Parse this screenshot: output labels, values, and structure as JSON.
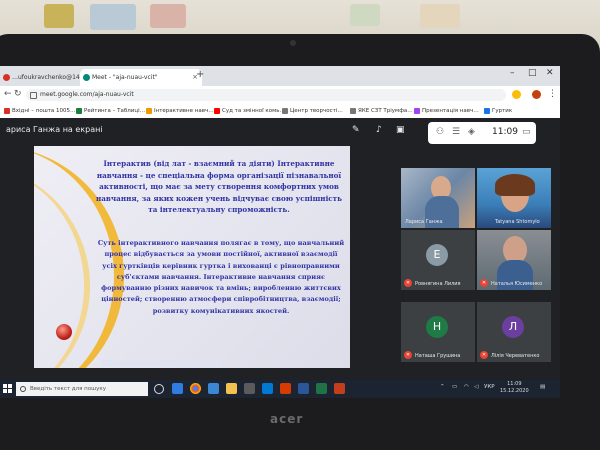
{
  "browser": {
    "tabs": [
      {
        "label": "…ufoukravchenko@14 ✉",
        "active": false
      },
      {
        "label": "Meet - \"aja-nuau-vcit\"",
        "active": true
      }
    ],
    "url": "meet.google.com/aja-nuau-vcit",
    "bookmarks": [
      "Вхідні – пошта 1005…",
      "Рейтинга – Таблиці…",
      "Інтерактивне навч…",
      "Суд та змінної комь…",
      "Центр творчості…",
      "ЯКЕ СЗТ Тріумфа…",
      "Презентація навч…",
      "Гуртик"
    ]
  },
  "meet": {
    "presenter_label": "ариса Ганжа на екрані",
    "time": "11:09",
    "slide": {
      "heading": "Інтерактив (від лат - взаємний та діяти) Інтерактивне навчання - це спеціальна форма організації пізнавальної активності, що має за мету створення комфортних умов навчання, за яких кожен учень відчуває свою успішність та інтелектуальну спроможність.",
      "body": "Суть інтерактивного навчання полягає в тому, що навчальний процес відбувається за умови постійної, активної взаємодії усіх гуртківців керівник гуртка і вихованці є рівноправними суб'єктами навчання. Інтерактивне навчання сприяє формуванню різних навичок та вмінь; виробленню життєвих цінностей; створенню атмосфери співробітництва, взаємодії; розвитку комунікативних якостей."
    },
    "participants": [
      {
        "name": "Лариса Ганжа",
        "initial": "",
        "color": "#5f6368"
      },
      {
        "name": "Tatyana Shtomylo",
        "initial": "",
        "color": "#5f6368"
      },
      {
        "name": "Ровнягина Лилия",
        "initial": "Е",
        "color": "#8a9ba6"
      },
      {
        "name": "Наталья Юсименко",
        "initial": "",
        "color": "#5f6368"
      },
      {
        "name": "Наташа Грушина",
        "initial": "Н",
        "color": "#1e7b45"
      },
      {
        "name": "Лілія Череватенко",
        "initial": "Л",
        "color": "#6b3fa0"
      }
    ]
  },
  "taskbar": {
    "search_placeholder": "Введіть текст для пошуку",
    "tray_lang": "УКР",
    "clock_time": "11:09",
    "clock_date": "15.12.2020"
  }
}
